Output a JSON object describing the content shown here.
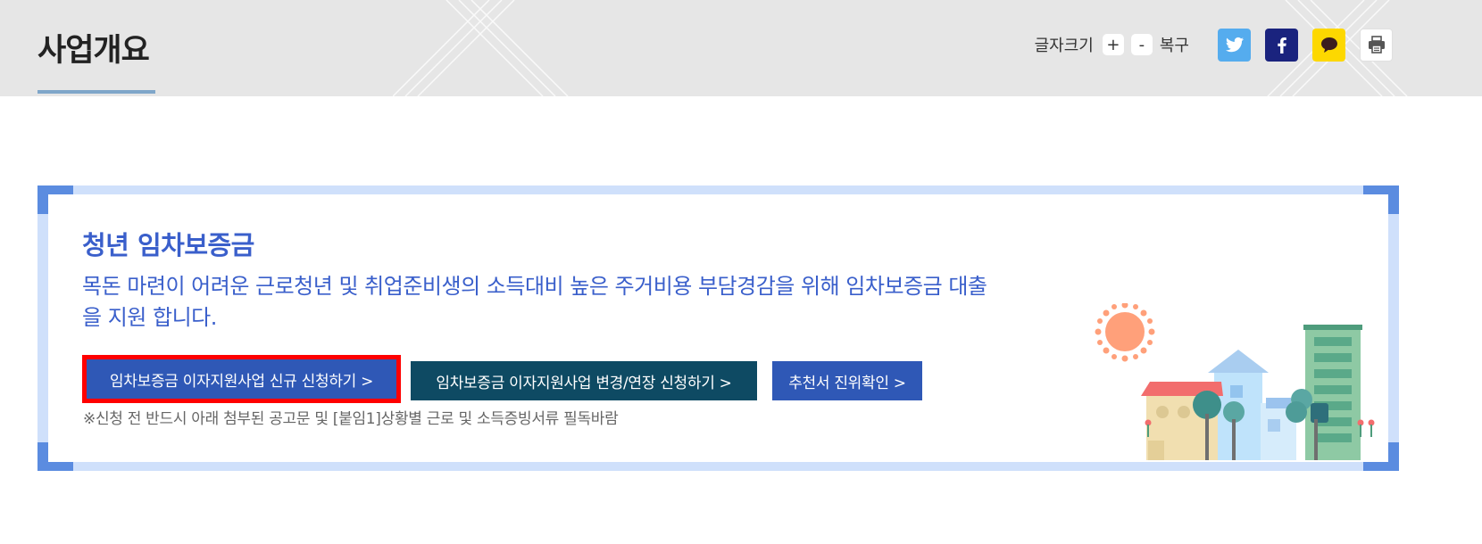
{
  "header": {
    "title": "사업개요",
    "font_size_label": "글자크기",
    "font_increase": "+",
    "font_decrease": "-",
    "reset_label": "복구",
    "share_icons": [
      "twitter-icon",
      "facebook-icon",
      "kakaotalk-icon",
      "print-icon"
    ]
  },
  "banner": {
    "title": "청년 임차보증금",
    "description": "목돈 마련이 어려운 근로청년 및 취업준비생의 소득대비 높은 주거비용 부담경감을 위해 임차보증금 대출을 지원 합니다.",
    "buttons": {
      "new_application": "임차보증금 이자지원사업 신규 신청하기 >",
      "change_application": "임차보증금 이자지원사업 변경/연장 신청하기 >",
      "recommendation_check": "추천서 진위확인 >"
    },
    "note": "※신청 전 반드시 아래 첨부된 공고문 및 [붙임1]상황별 근로 및 소득증빙서류 필독바람"
  },
  "colors": {
    "accent_blue": "#2f58b6",
    "dark_teal": "#0e4a63",
    "highlight_red": "#ff0000",
    "banner_text": "#3a5fcb"
  }
}
